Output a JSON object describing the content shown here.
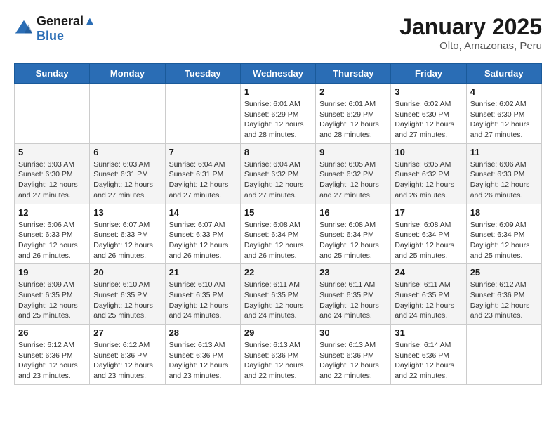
{
  "header": {
    "logo_line1": "General",
    "logo_line2": "Blue",
    "month": "January 2025",
    "location": "Olto, Amazonas, Peru"
  },
  "days_of_week": [
    "Sunday",
    "Monday",
    "Tuesday",
    "Wednesday",
    "Thursday",
    "Friday",
    "Saturday"
  ],
  "weeks": [
    [
      {
        "day": "",
        "info": ""
      },
      {
        "day": "",
        "info": ""
      },
      {
        "day": "",
        "info": ""
      },
      {
        "day": "1",
        "info": "Sunrise: 6:01 AM\nSunset: 6:29 PM\nDaylight: 12 hours\nand 28 minutes."
      },
      {
        "day": "2",
        "info": "Sunrise: 6:01 AM\nSunset: 6:29 PM\nDaylight: 12 hours\nand 28 minutes."
      },
      {
        "day": "3",
        "info": "Sunrise: 6:02 AM\nSunset: 6:30 PM\nDaylight: 12 hours\nand 27 minutes."
      },
      {
        "day": "4",
        "info": "Sunrise: 6:02 AM\nSunset: 6:30 PM\nDaylight: 12 hours\nand 27 minutes."
      }
    ],
    [
      {
        "day": "5",
        "info": "Sunrise: 6:03 AM\nSunset: 6:30 PM\nDaylight: 12 hours\nand 27 minutes."
      },
      {
        "day": "6",
        "info": "Sunrise: 6:03 AM\nSunset: 6:31 PM\nDaylight: 12 hours\nand 27 minutes."
      },
      {
        "day": "7",
        "info": "Sunrise: 6:04 AM\nSunset: 6:31 PM\nDaylight: 12 hours\nand 27 minutes."
      },
      {
        "day": "8",
        "info": "Sunrise: 6:04 AM\nSunset: 6:32 PM\nDaylight: 12 hours\nand 27 minutes."
      },
      {
        "day": "9",
        "info": "Sunrise: 6:05 AM\nSunset: 6:32 PM\nDaylight: 12 hours\nand 27 minutes."
      },
      {
        "day": "10",
        "info": "Sunrise: 6:05 AM\nSunset: 6:32 PM\nDaylight: 12 hours\nand 26 minutes."
      },
      {
        "day": "11",
        "info": "Sunrise: 6:06 AM\nSunset: 6:33 PM\nDaylight: 12 hours\nand 26 minutes."
      }
    ],
    [
      {
        "day": "12",
        "info": "Sunrise: 6:06 AM\nSunset: 6:33 PM\nDaylight: 12 hours\nand 26 minutes."
      },
      {
        "day": "13",
        "info": "Sunrise: 6:07 AM\nSunset: 6:33 PM\nDaylight: 12 hours\nand 26 minutes."
      },
      {
        "day": "14",
        "info": "Sunrise: 6:07 AM\nSunset: 6:33 PM\nDaylight: 12 hours\nand 26 minutes."
      },
      {
        "day": "15",
        "info": "Sunrise: 6:08 AM\nSunset: 6:34 PM\nDaylight: 12 hours\nand 26 minutes."
      },
      {
        "day": "16",
        "info": "Sunrise: 6:08 AM\nSunset: 6:34 PM\nDaylight: 12 hours\nand 25 minutes."
      },
      {
        "day": "17",
        "info": "Sunrise: 6:08 AM\nSunset: 6:34 PM\nDaylight: 12 hours\nand 25 minutes."
      },
      {
        "day": "18",
        "info": "Sunrise: 6:09 AM\nSunset: 6:34 PM\nDaylight: 12 hours\nand 25 minutes."
      }
    ],
    [
      {
        "day": "19",
        "info": "Sunrise: 6:09 AM\nSunset: 6:35 PM\nDaylight: 12 hours\nand 25 minutes."
      },
      {
        "day": "20",
        "info": "Sunrise: 6:10 AM\nSunset: 6:35 PM\nDaylight: 12 hours\nand 25 minutes."
      },
      {
        "day": "21",
        "info": "Sunrise: 6:10 AM\nSunset: 6:35 PM\nDaylight: 12 hours\nand 24 minutes."
      },
      {
        "day": "22",
        "info": "Sunrise: 6:11 AM\nSunset: 6:35 PM\nDaylight: 12 hours\nand 24 minutes."
      },
      {
        "day": "23",
        "info": "Sunrise: 6:11 AM\nSunset: 6:35 PM\nDaylight: 12 hours\nand 24 minutes."
      },
      {
        "day": "24",
        "info": "Sunrise: 6:11 AM\nSunset: 6:35 PM\nDaylight: 12 hours\nand 24 minutes."
      },
      {
        "day": "25",
        "info": "Sunrise: 6:12 AM\nSunset: 6:36 PM\nDaylight: 12 hours\nand 23 minutes."
      }
    ],
    [
      {
        "day": "26",
        "info": "Sunrise: 6:12 AM\nSunset: 6:36 PM\nDaylight: 12 hours\nand 23 minutes."
      },
      {
        "day": "27",
        "info": "Sunrise: 6:12 AM\nSunset: 6:36 PM\nDaylight: 12 hours\nand 23 minutes."
      },
      {
        "day": "28",
        "info": "Sunrise: 6:13 AM\nSunset: 6:36 PM\nDaylight: 12 hours\nand 23 minutes."
      },
      {
        "day": "29",
        "info": "Sunrise: 6:13 AM\nSunset: 6:36 PM\nDaylight: 12 hours\nand 22 minutes."
      },
      {
        "day": "30",
        "info": "Sunrise: 6:13 AM\nSunset: 6:36 PM\nDaylight: 12 hours\nand 22 minutes."
      },
      {
        "day": "31",
        "info": "Sunrise: 6:14 AM\nSunset: 6:36 PM\nDaylight: 12 hours\nand 22 minutes."
      },
      {
        "day": "",
        "info": ""
      }
    ]
  ]
}
